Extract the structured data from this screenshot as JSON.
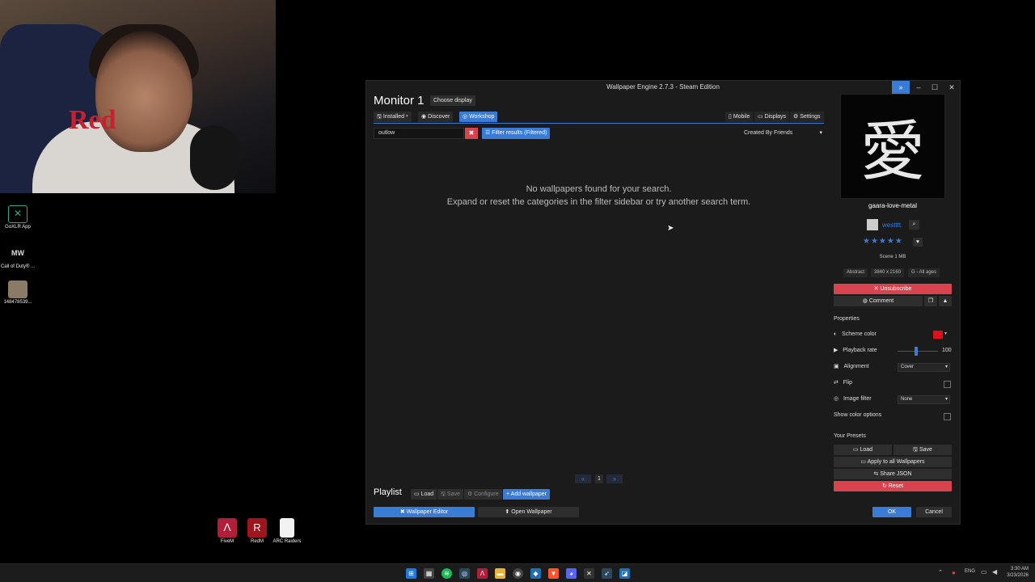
{
  "desktop_icons": [
    {
      "label": "GoXLR App",
      "glyph": "✕"
    },
    {
      "label": "Call of Duty® ...",
      "glyph": "MW"
    },
    {
      "label": "148478539...",
      "glyph": ""
    }
  ],
  "bottom_icons": [
    {
      "label": "FiveM",
      "glyph": "Λ"
    },
    {
      "label": "RedM",
      "glyph": "R"
    },
    {
      "label": "ARC Raiders",
      "glyph": ""
    }
  ],
  "webcam": {
    "brand": "Red"
  },
  "window": {
    "title": "Wallpaper Engine 2.7.3 - Steam Edition",
    "monitor_title": "Monitor 1",
    "choose_display": "Choose display",
    "tabs": {
      "installed": "Installed",
      "discover": "Discover",
      "workshop": "Workshop"
    },
    "top_right": {
      "mobile": "Mobile",
      "displays": "Displays",
      "settings": "Settings"
    },
    "search_value": "outlow",
    "filter_results": "Filter results (Filtered)",
    "sort_value": "Created By Friends",
    "empty_line1": "No wallpapers found for your search.",
    "empty_line2": "Expand or reset the categories in the filter sidebar or try another search term.",
    "pagination": {
      "page": "1"
    },
    "playlist": {
      "label": "Playlist",
      "load": "Load",
      "save": "Save",
      "configure": "Configure",
      "add": "Add wallpaper"
    },
    "wallpaper_editor": "Wallpaper Editor",
    "open_wallpaper": "Open Wallpaper",
    "ok": "OK",
    "cancel": "Cancel"
  },
  "detail": {
    "preview_glyph": "愛",
    "name": "gaara-love-metal",
    "author": "westttt.",
    "stars": "★★★★★",
    "meta": "Scene 1 MB",
    "tags": [
      "Abstract",
      "3840 x 2160",
      "G - All ages"
    ],
    "unsubscribe": "Unsubscribe",
    "comment": "Comment",
    "properties_label": "Properties",
    "props": {
      "scheme_color": "Scheme color",
      "playback_rate": "Playback rate",
      "playback_value": "100",
      "playback_level": 0.45,
      "alignment": "Alignment",
      "alignment_value": "Cover",
      "flip": "Flip",
      "image_filter": "Image filter",
      "image_filter_value": "None",
      "show_color": "Show color options"
    },
    "scheme_color_hex": "#e0101a",
    "presets_label": "Your Presets",
    "preset_load": "Load",
    "preset_save": "Save",
    "apply_all": "Apply to all Wallpapers",
    "share_json": "Share JSON",
    "reset": "Reset"
  },
  "tray": {
    "lang": "ENG",
    "time": "3:30 AM",
    "date": "3/23/2026"
  },
  "colors": {
    "accent": "#3a7bd5",
    "danger": "#d9434e"
  }
}
